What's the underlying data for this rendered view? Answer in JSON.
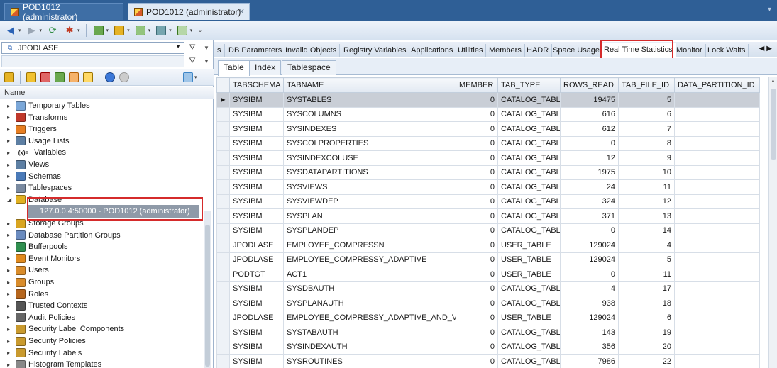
{
  "doc_tabs": [
    {
      "label": "POD1012 (administrator)"
    },
    {
      "label": "POD1012 (administrator)",
      "close": "✕"
    }
  ],
  "connection": {
    "selected": "JPODLASE"
  },
  "tree_header": "Name",
  "tree": [
    {
      "label": "Temporary Tables",
      "icon": "table-icon"
    },
    {
      "label": "Transforms",
      "icon": "transform-icon"
    },
    {
      "label": "Triggers",
      "icon": "trigger-icon"
    },
    {
      "label": "Usage Lists",
      "icon": "list-icon"
    },
    {
      "label": "Variables",
      "icon": "variable-icon",
      "glyph": "(x)="
    },
    {
      "label": "Views",
      "icon": "view-icon"
    },
    {
      "label": "Schemas",
      "icon": "schema-icon"
    },
    {
      "label": "Tablespaces",
      "icon": "tablespace-icon"
    },
    {
      "label": "Database",
      "icon": "database-icon",
      "expanded": true
    },
    {
      "label": "Storage Groups",
      "icon": "storage-icon"
    },
    {
      "label": "Database Partition Groups",
      "icon": "partition-icon"
    },
    {
      "label": "Bufferpools",
      "icon": "bufferpool-icon"
    },
    {
      "label": "Event Monitors",
      "icon": "monitor-icon"
    },
    {
      "label": "Users",
      "icon": "user-icon"
    },
    {
      "label": "Groups",
      "icon": "group-icon"
    },
    {
      "label": "Roles",
      "icon": "role-icon"
    },
    {
      "label": "Trusted Contexts",
      "icon": "context-icon"
    },
    {
      "label": "Audit Policies",
      "icon": "audit-icon"
    },
    {
      "label": "Security Label Components",
      "icon": "security-icon"
    },
    {
      "label": "Security Policies",
      "icon": "security-icon"
    },
    {
      "label": "Security Labels",
      "icon": "security-icon"
    },
    {
      "label": "Histogram Templates",
      "icon": "histogram-icon"
    }
  ],
  "database_child": "127.0.0.4:50000 - POD1012 (administrator)",
  "category_tabs": [
    {
      "label": "s"
    },
    {
      "label": "DB Parameters"
    },
    {
      "label": "Invalid Objects"
    },
    {
      "label": "Registry Variables"
    },
    {
      "label": "Applications"
    },
    {
      "label": "Utilities"
    },
    {
      "label": "Members"
    },
    {
      "label": "HADR"
    },
    {
      "label": "Space Usage"
    },
    {
      "label": "Real Time Statistics",
      "active": true
    },
    {
      "label": "Monitor"
    },
    {
      "label": "Lock Waits"
    }
  ],
  "sub_tabs": [
    {
      "label": "Table",
      "active": true
    },
    {
      "label": "Index"
    },
    {
      "label": "Tablespace"
    }
  ],
  "columns": [
    "TABSCHEMA",
    "TABNAME",
    "MEMBER",
    "TAB_TYPE",
    "ROWS_READ",
    "TAB_FILE_ID",
    "DATA_PARTITION_ID"
  ],
  "rows": [
    [
      "SYSIBM",
      "SYSTABLES",
      "0",
      "CATALOG_TABLE",
      "19475",
      "5",
      ""
    ],
    [
      "SYSIBM",
      "SYSCOLUMNS",
      "0",
      "CATALOG_TABLE",
      "616",
      "6",
      ""
    ],
    [
      "SYSIBM",
      "SYSINDEXES",
      "0",
      "CATALOG_TABLE",
      "612",
      "7",
      ""
    ],
    [
      "SYSIBM",
      "SYSCOLPROPERTIES",
      "0",
      "CATALOG_TABLE",
      "0",
      "8",
      ""
    ],
    [
      "SYSIBM",
      "SYSINDEXCOLUSE",
      "0",
      "CATALOG_TABLE",
      "12",
      "9",
      ""
    ],
    [
      "SYSIBM",
      "SYSDATAPARTITIONS",
      "0",
      "CATALOG_TABLE",
      "1975",
      "10",
      ""
    ],
    [
      "SYSIBM",
      "SYSVIEWS",
      "0",
      "CATALOG_TABLE",
      "24",
      "11",
      ""
    ],
    [
      "SYSIBM",
      "SYSVIEWDEP",
      "0",
      "CATALOG_TABLE",
      "324",
      "12",
      ""
    ],
    [
      "SYSIBM",
      "SYSPLAN",
      "0",
      "CATALOG_TABLE",
      "371",
      "13",
      ""
    ],
    [
      "SYSIBM",
      "SYSPLANDEP",
      "0",
      "CATALOG_TABLE",
      "0",
      "14",
      ""
    ],
    [
      "JPODLASE",
      "EMPLOYEE_COMPRESSN",
      "0",
      "USER_TABLE",
      "129024",
      "4",
      ""
    ],
    [
      "JPODLASE",
      "EMPLOYEE_COMPRESSY_ADAPTIVE",
      "0",
      "USER_TABLE",
      "129024",
      "5",
      ""
    ],
    [
      "PODTGT",
      "ACT1",
      "0",
      "USER_TABLE",
      "0",
      "11",
      ""
    ],
    [
      "SYSIBM",
      "SYSDBAUTH",
      "0",
      "CATALOG_TABLE",
      "4",
      "17",
      ""
    ],
    [
      "SYSIBM",
      "SYSPLANAUTH",
      "0",
      "CATALOG_TABLE",
      "938",
      "18",
      ""
    ],
    [
      "JPODLASE",
      "EMPLOYEE_COMPRESSY_ADAPTIVE_AND_VALUES",
      "0",
      "USER_TABLE",
      "129024",
      "6",
      ""
    ],
    [
      "SYSIBM",
      "SYSTABAUTH",
      "0",
      "CATALOG_TABLE",
      "143",
      "19",
      ""
    ],
    [
      "SYSIBM",
      "SYSINDEXAUTH",
      "0",
      "CATALOG_TABLE",
      "356",
      "20",
      ""
    ],
    [
      "SYSIBM",
      "SYSROUTINES",
      "0",
      "CATALOG_TABLE",
      "7986",
      "22",
      ""
    ]
  ],
  "selected_row": 0,
  "colors": {
    "highlight": "#d52b2b",
    "title_bar": "#2f5f96",
    "selected_row": "#c9ced6"
  }
}
